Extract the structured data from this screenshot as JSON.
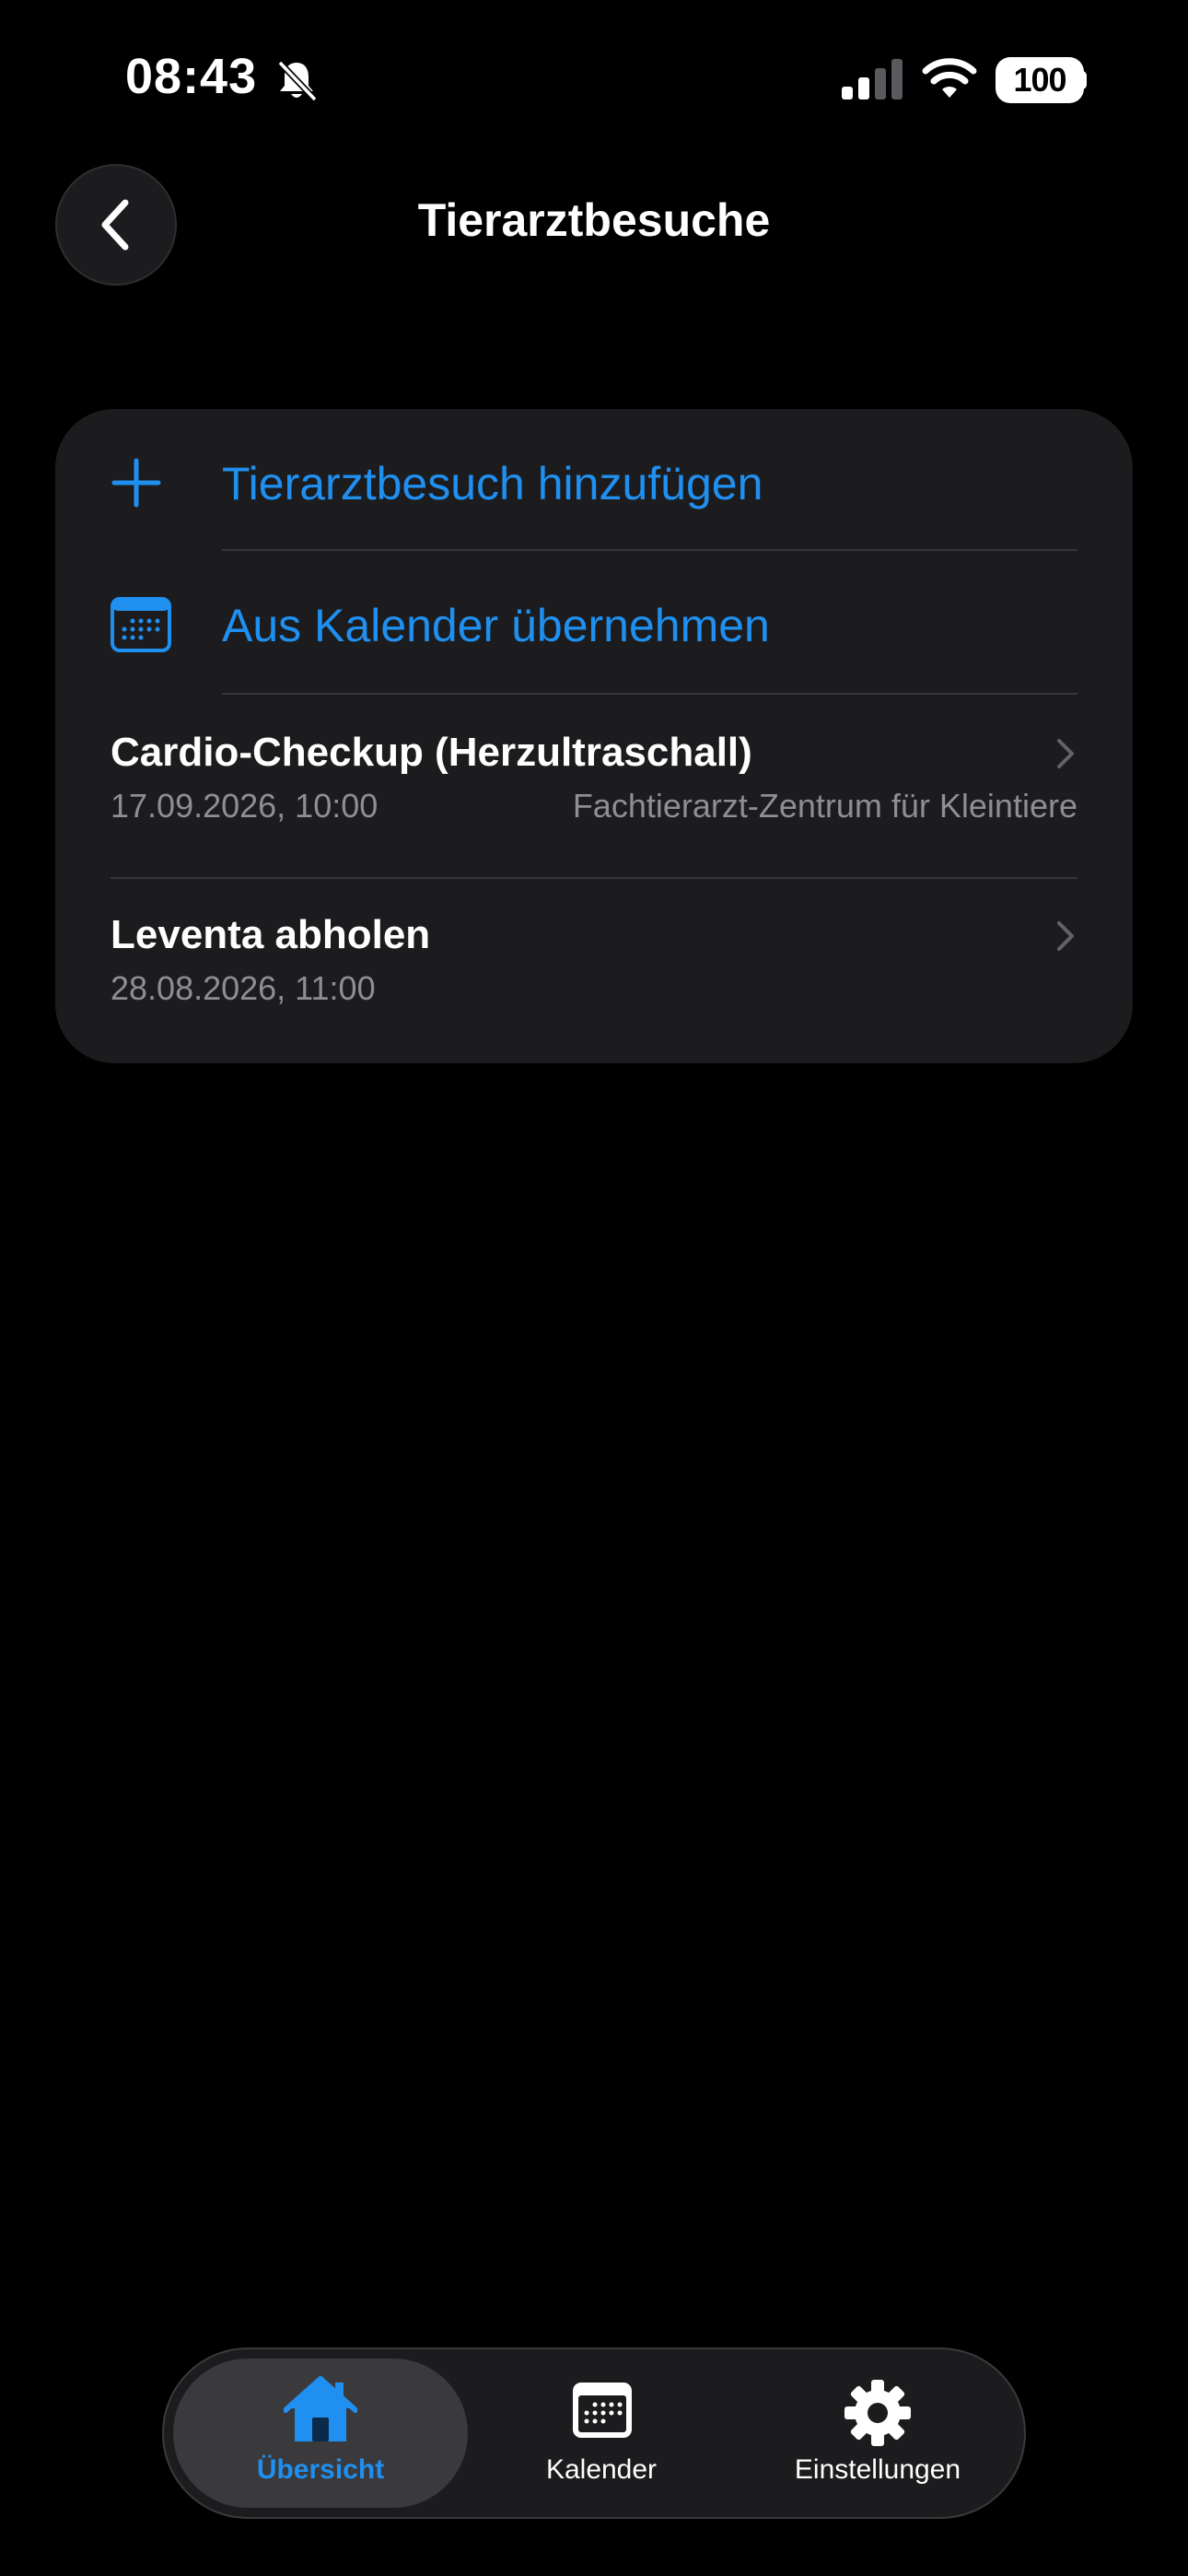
{
  "status_bar": {
    "time": "08:43",
    "battery": "100",
    "icons": [
      "bell-slash-icon",
      "cellular-signal-icon",
      "wifi-icon",
      "battery-icon"
    ]
  },
  "nav": {
    "title": "Tierarztbesuche",
    "back_icon": "chevron-left-icon"
  },
  "actions": [
    {
      "label": "Tierarztbesuch hinzufügen",
      "icon": "plus-icon"
    },
    {
      "label": "Aus Kalender übernehmen",
      "icon": "calendar-icon"
    }
  ],
  "visits": [
    {
      "title": "Cardio-Checkup (Herzultraschall)",
      "datetime": "17.09.2026, 10:00",
      "place": "Fachtierarzt-Zentrum für Kleintiere"
    },
    {
      "title": "Leventa abholen",
      "datetime": "28.08.2026, 11:00",
      "place": ""
    }
  ],
  "tabs": [
    {
      "label": "Übersicht",
      "icon": "house-icon",
      "active": true
    },
    {
      "label": "Kalender",
      "icon": "calendar-icon",
      "active": false
    },
    {
      "label": "Einstellungen",
      "icon": "gear-icon",
      "active": false
    }
  ],
  "colors": {
    "accent": "#1f8ff0",
    "background": "#000000",
    "card": "#1c1c1e",
    "secondary_text": "#8e8e93"
  }
}
